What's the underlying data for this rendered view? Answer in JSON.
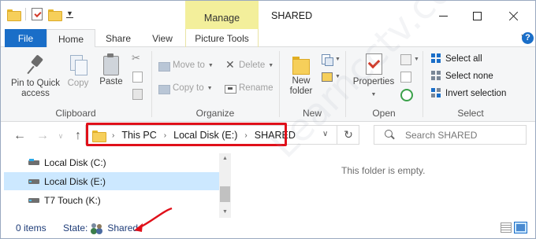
{
  "window": {
    "title": "SHARED",
    "context_tab": "Manage"
  },
  "tabs": {
    "file": "File",
    "home": "Home",
    "share": "Share",
    "view": "View",
    "picture_tools": "Picture Tools",
    "help": "?"
  },
  "ribbon": {
    "clipboard": {
      "label": "Clipboard",
      "pin_line1": "Pin to Quick",
      "pin_line2": "access",
      "copy": "Copy",
      "paste": "Paste"
    },
    "organize": {
      "label": "Organize",
      "move_to": "Move to",
      "copy_to": "Copy to",
      "delete": "Delete",
      "rename": "Rename"
    },
    "new": {
      "label": "New",
      "new_folder_line1": "New",
      "new_folder_line2": "folder"
    },
    "open": {
      "label": "Open",
      "properties": "Properties"
    },
    "select": {
      "label": "Select",
      "select_all": "Select all",
      "select_none": "Select none",
      "invert_selection": "Invert selection"
    }
  },
  "address": {
    "breadcrumbs": [
      "This PC",
      "Local Disk (E:)",
      "SHARED"
    ],
    "highlight_color": "#e0101a"
  },
  "search": {
    "placeholder": "Search SHARED"
  },
  "nav_tree": {
    "items": [
      {
        "label": "Local Disk (C:)",
        "selected": false
      },
      {
        "label": "Local Disk (E:)",
        "selected": true
      },
      {
        "label": "T7 Touch (K:)",
        "selected": false
      }
    ]
  },
  "content": {
    "empty_message": "This folder is empty."
  },
  "status": {
    "item_count": "0 items",
    "state_label": "State:",
    "state_value": "Shared"
  },
  "watermark": "Learncctv.com",
  "colors": {
    "accent": "#1a6ec8",
    "manage_tab": "#f3ef9b",
    "selection": "#cce8ff",
    "annotation_red": "#e0101a"
  }
}
